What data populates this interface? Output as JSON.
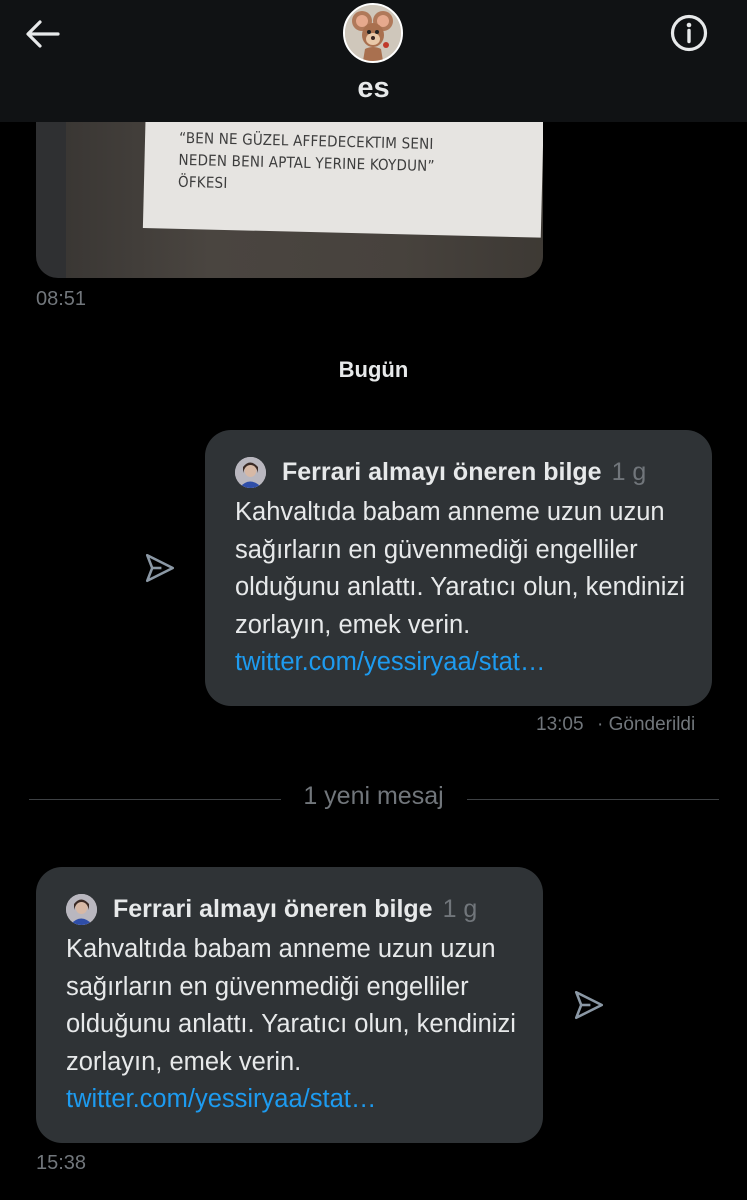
{
  "header": {
    "back_icon": "arrow-left-icon",
    "conversation_name": "es",
    "info_icon": "info-circle-icon"
  },
  "messages": {
    "image_message": {
      "photo_text": [
        "“BEN NE GÜZEL AFFEDECEKTIM SENI",
        "NEDEN BENI APTAL YERINE KOYDUN”",
        "ÖFKESI"
      ],
      "time": "08:51"
    },
    "day_separator": "Bugün",
    "sent_tweet": {
      "author": "Ferrari almayı öneren bilge",
      "age": "1 g",
      "text": "Kahvaltıda babam anneme uzun uzun sağırların en güvenmediği engelliler olduğunu anlattı. Yaratıcı olun, kendinizi zorlayın, emek verin.",
      "link": "twitter.com/yessiryaa/stat…",
      "time": "13:05",
      "status": "· Gönderildi",
      "share_icon": "send-icon"
    },
    "new_messages_divider": "1 yeni mesaj",
    "received_tweet": {
      "author": "Ferrari almayı öneren bilge",
      "age": "1 g",
      "text": "Kahvaltıda babam anneme uzun uzun sağırların en güvenmediği engelliler olduğunu anlattı. Yaratıcı olun, kendinizi zorlayın, emek verin.",
      "link": "twitter.com/yessiryaa/stat…",
      "time": "15:38",
      "share_icon": "send-icon"
    }
  },
  "colors": {
    "background": "#000000",
    "header_bg": "#101214",
    "bubble_bg": "#2f3336",
    "text_primary": "#e7e9ea",
    "text_secondary": "#71767b",
    "link": "#1d9bf0"
  }
}
